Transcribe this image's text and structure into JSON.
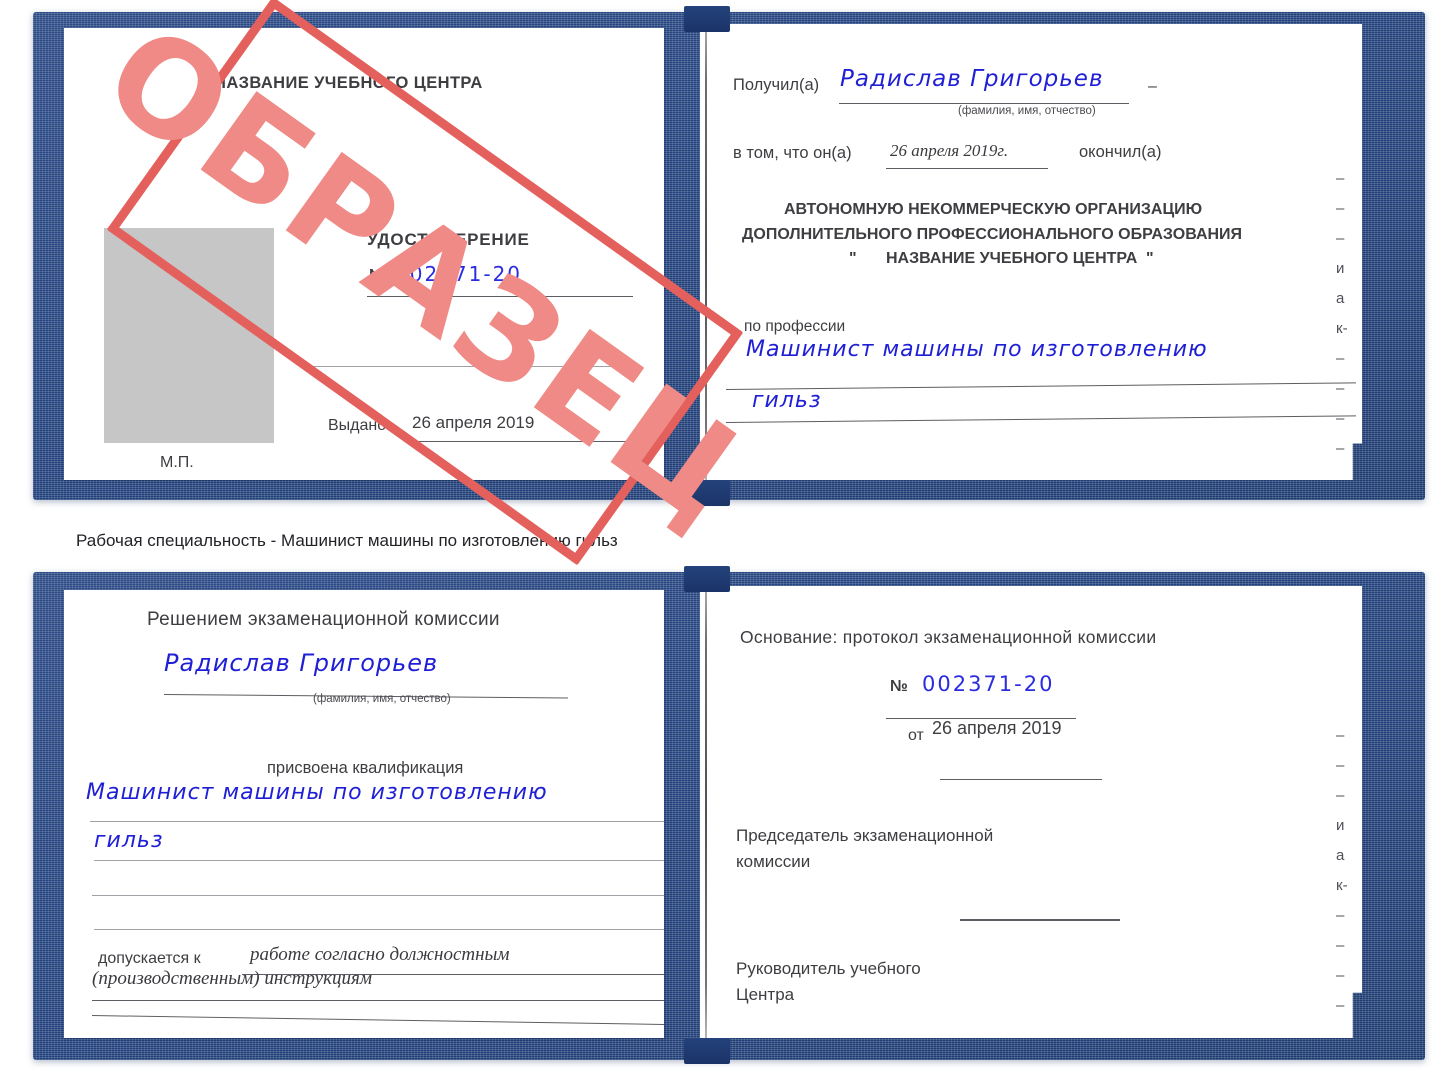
{
  "document": {
    "caption": "Рабочая специальность - Машинист машины по изготовлению гильз",
    "watermark": "ОБРАЗЕЦ",
    "ink_color": "#1f1fd6",
    "stamp_color": "#e4605c",
    "stamp_text_color": "#ef8a86",
    "cover_color": "#22427d"
  },
  "spread_top": {
    "left_page": {
      "center_name": "НАЗВАНИЕ УЧЕБНОГО ЦЕНТРА",
      "title": "УДОСТОВЕРЕНИЕ",
      "number_label": "№",
      "number_value": "002371-20",
      "issued_label": "Выдано",
      "issued_value": "26 апреля 2019",
      "seal_label": "М.П.",
      "photo_placeholder": "photo-area"
    },
    "right_page": {
      "received_label": "Получил(а)",
      "received_value": "Радислав Григорьев",
      "received_hint": "(фамилия, имя, отчество)",
      "in_that_label": "в том, что он(а)",
      "completion_date": "26 апреля 2019г.",
      "finished_label": "окончил(а)",
      "org_line1": "АВТОНОМНУЮ НЕКОММЕРЧЕСКУЮ ОРГАНИЗАЦИЮ",
      "org_line2": "ДОПОЛНИТЕЛЬНОГО ПРОФЕССИОНАЛЬНОГО ОБРАЗОВАНИЯ",
      "org_quote_open": "\"",
      "org_name": "НАЗВАНИЕ УЧЕБНОГО ЦЕНТРА",
      "org_quote_close": "\"",
      "profession_label": "по профессии",
      "profession_line1": "Машинист машины по изготовлению",
      "profession_line2": "гильз",
      "edge_glyphs": [
        "–",
        "–",
        "–",
        "и",
        "а",
        "к-",
        "–",
        "–",
        "–",
        "–"
      ]
    }
  },
  "spread_bottom": {
    "left_page": {
      "heading": "Решением экзаменационной комиссии",
      "name_value": "Радислав Григорьев",
      "name_hint": "(фамилия, имя, отчество)",
      "qualification_label": "присвоена квалификация",
      "qualification_line1": "Машинист машины по изготовлению",
      "qualification_line2": "гильз",
      "admitted_label": "допускается к",
      "admitted_line1": "работе согласно должностным",
      "admitted_line2": "(производственным) инструкциям"
    },
    "right_page": {
      "basis_label": "Основание: протокол экзаменационной комиссии",
      "number_label": "№",
      "number_value": "002371-20",
      "date_label": "от",
      "date_value": "26 апреля 2019",
      "chairman_line1": "Председатель экзаменационной",
      "chairman_line2": "комиссии",
      "director_line1": "Руководитель учебного",
      "director_line2": "Центра",
      "edge_glyphs": [
        "–",
        "–",
        "–",
        "и",
        "а",
        "к-",
        "–",
        "–",
        "–",
        "–"
      ]
    }
  }
}
